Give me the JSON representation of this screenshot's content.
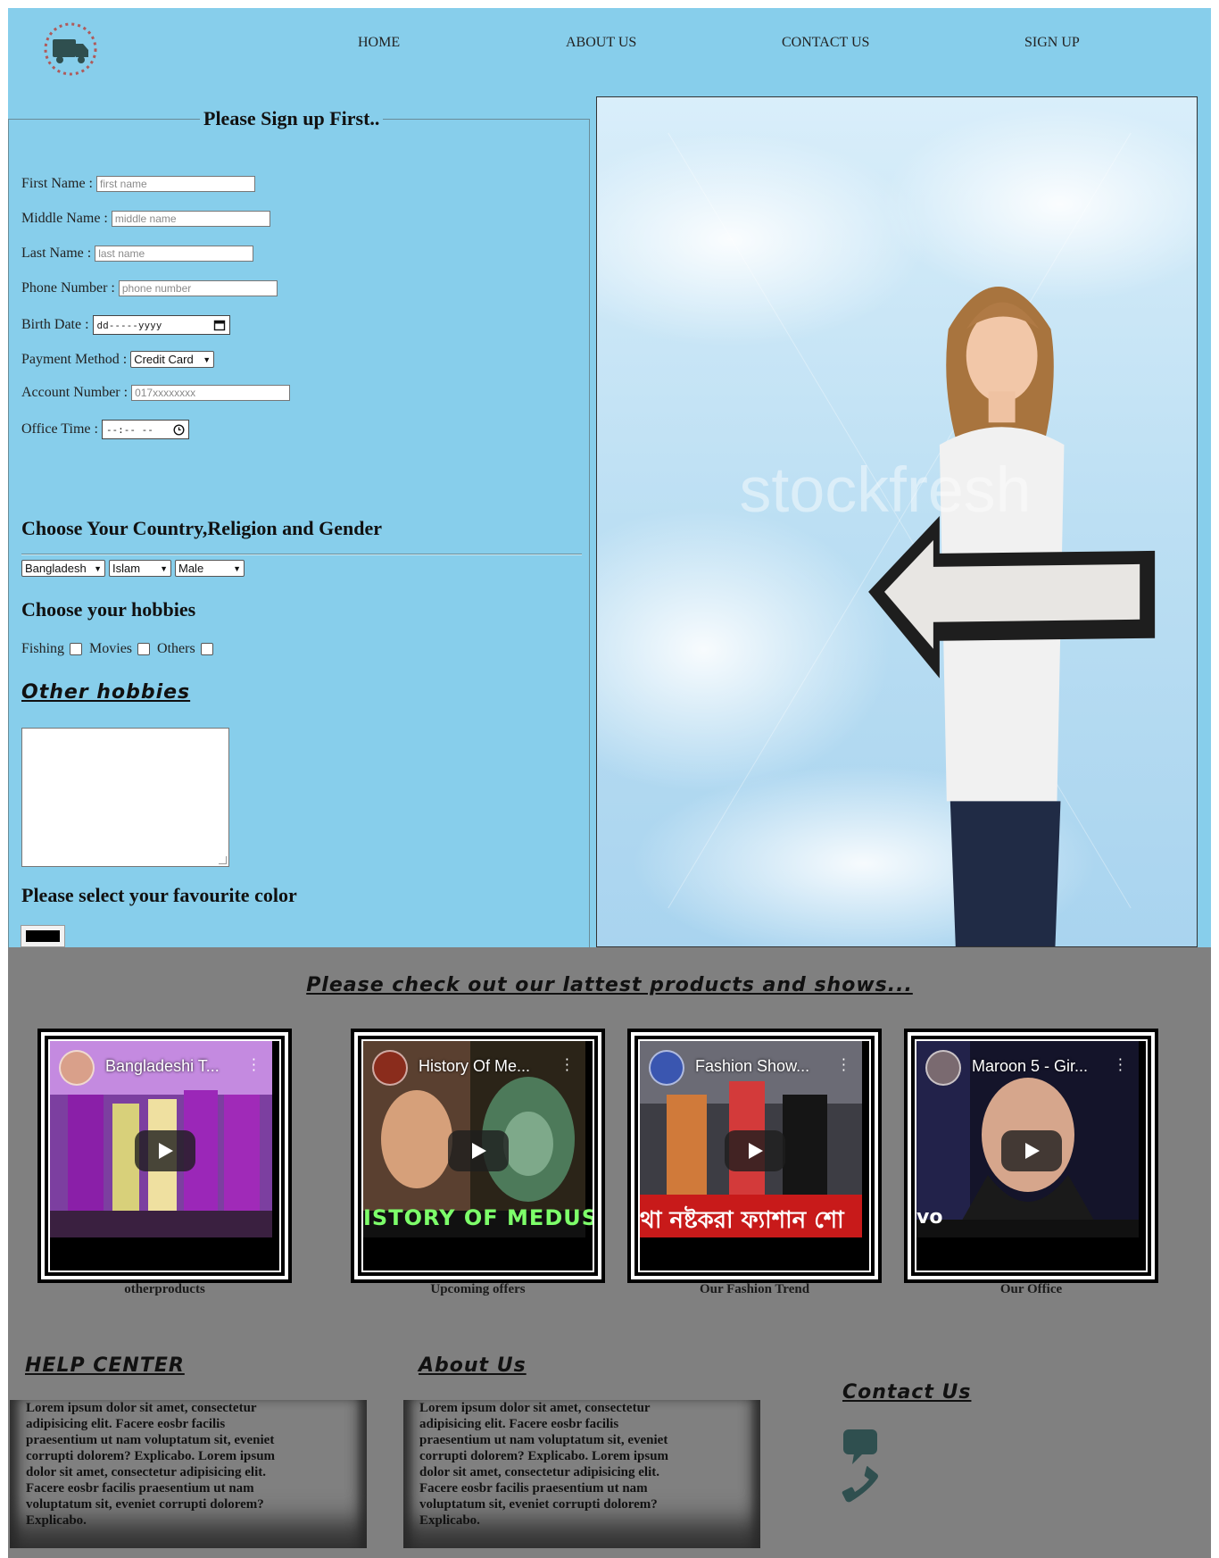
{
  "nav": {
    "items": [
      "HOME",
      "ABOUT US",
      "CONTACT US",
      "SIGN UP"
    ]
  },
  "form": {
    "legend": "Please Sign up First..",
    "first_name": {
      "label": "First Name :",
      "placeholder": "first name"
    },
    "middle_name": {
      "label": "Middle Name :",
      "placeholder": "middle name"
    },
    "last_name": {
      "label": "Last Name :",
      "placeholder": "last name"
    },
    "phone": {
      "label": "Phone Number :",
      "placeholder": "phone number"
    },
    "birth_date": {
      "label": "Birth Date :",
      "value": "dd-----yyyy"
    },
    "payment": {
      "label": "Payment Method :",
      "value": "Credit Card"
    },
    "account": {
      "label": "Account Number :",
      "placeholder": "017xxxxxxxx"
    },
    "office_time": {
      "label": "Office Time :",
      "value": "--:-- --"
    },
    "country_heading": "Choose Your Country,Religion and Gender",
    "country": "Bangladesh",
    "religion": "Islam",
    "gender": "Male",
    "hobbies_heading": "Choose your hobbies",
    "hobbies": [
      "Fishing",
      "Movies",
      "Others"
    ],
    "other_hobbies_heading": "Other hobbies",
    "color_heading": "Please select your favourite color",
    "color_value": "#000000"
  },
  "hero": {
    "watermark": "stockfresh"
  },
  "products": {
    "title": "Please check out our lattest products and shows...",
    "videos": [
      {
        "title": "Bangladeshi T...",
        "caption": "otherproducts",
        "overlay": ""
      },
      {
        "title": "History Of Me...",
        "caption": "Upcoming offers",
        "overlay": "ISTORY OF MEDUSA"
      },
      {
        "title": "Fashion Show...",
        "caption": "Our Fashion Trend",
        "overlay": "থা নষ্টকরা ফ্যাশান শো"
      },
      {
        "title": "Maroon 5 - Gir...",
        "caption": "Our Office",
        "overlay": "vo"
      }
    ]
  },
  "footer": {
    "help_title": "HELP CENTER",
    "about_title": "About Us",
    "contact_title": "Contact Us",
    "lorem": "Lorem ipsum dolor sit amet, consectetur adipisicing elit. Facere eosbr facilis praesentium ut nam voluptatum sit, eveniet corrupti dolorem? Explicabo. Lorem ipsum dolor sit amet, consectetur adipisicing elit. Facere eosbr facilis praesentium ut nam voluptatum sit, eveniet corrupti dolorem? Explicabo."
  },
  "colors": {
    "top_bg": "#87ceeb",
    "bottom_bg": "#808080",
    "icon": "#2f4f4f"
  }
}
